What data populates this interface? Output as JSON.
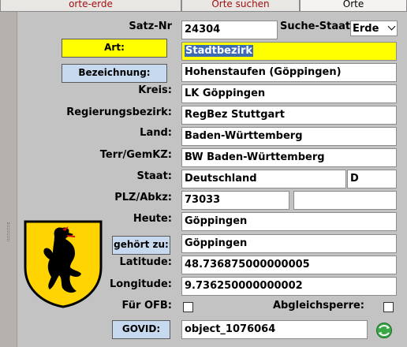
{
  "tabs": [
    {
      "label": "orte-erde"
    },
    {
      "label": "Orte suchen"
    },
    {
      "label": "Orte"
    }
  ],
  "colors": {
    "tab_text": "#a01010",
    "highlight": "#ffff00",
    "button_blue": "#c6d9ef"
  },
  "labels": {
    "satz_nr": "Satz-Nr",
    "suche_staat": "Suche-Staat:",
    "kreis": "Kreis:",
    "regierungsbezirk": "Regierungsbezirk:",
    "land": "Land:",
    "terr_gemkz": "Terr/GemKZ:",
    "staat": "Staat:",
    "plz_abkz": "PLZ/Abkz:",
    "heute": "Heute:",
    "latitude": "Latitude:",
    "longitude": "Longitude:",
    "fuer_ofb": "Für OFB:",
    "abgleichsperre": "Abgleichsperre:"
  },
  "buttons": {
    "art": "Art:",
    "bezeichnung": "Bezeichnung:",
    "gehoert_zu": "gehört zu:",
    "govid": "GOVID:"
  },
  "values": {
    "satz_nr": "24304",
    "suche_staat": "Erde",
    "art": "Stadtbezirk",
    "bezeichnung": "Hohenstaufen (Göppingen)",
    "kreis": "LK Göppingen",
    "regierungsbezirk": "RegBez Stuttgart",
    "land": "Baden-Württemberg",
    "terr_gemkz": "BW  Baden-Württemberg",
    "staat": "Deutschland",
    "staat_code": "D",
    "plz": "73033",
    "abkz": "",
    "heute": "Göppingen",
    "gehoert_zu": "Göppingen",
    "latitude": "48.736875000000005",
    "longitude": "9.736250000000002",
    "govid": "object_1076064"
  },
  "checkboxes": {
    "fuer_ofb": false,
    "abgleichsperre": false
  },
  "icons": {
    "coat_of_arms": "coat-of-arms-icon",
    "refresh": "refresh-globe-icon",
    "dropdown": "chevron-down-icon"
  }
}
